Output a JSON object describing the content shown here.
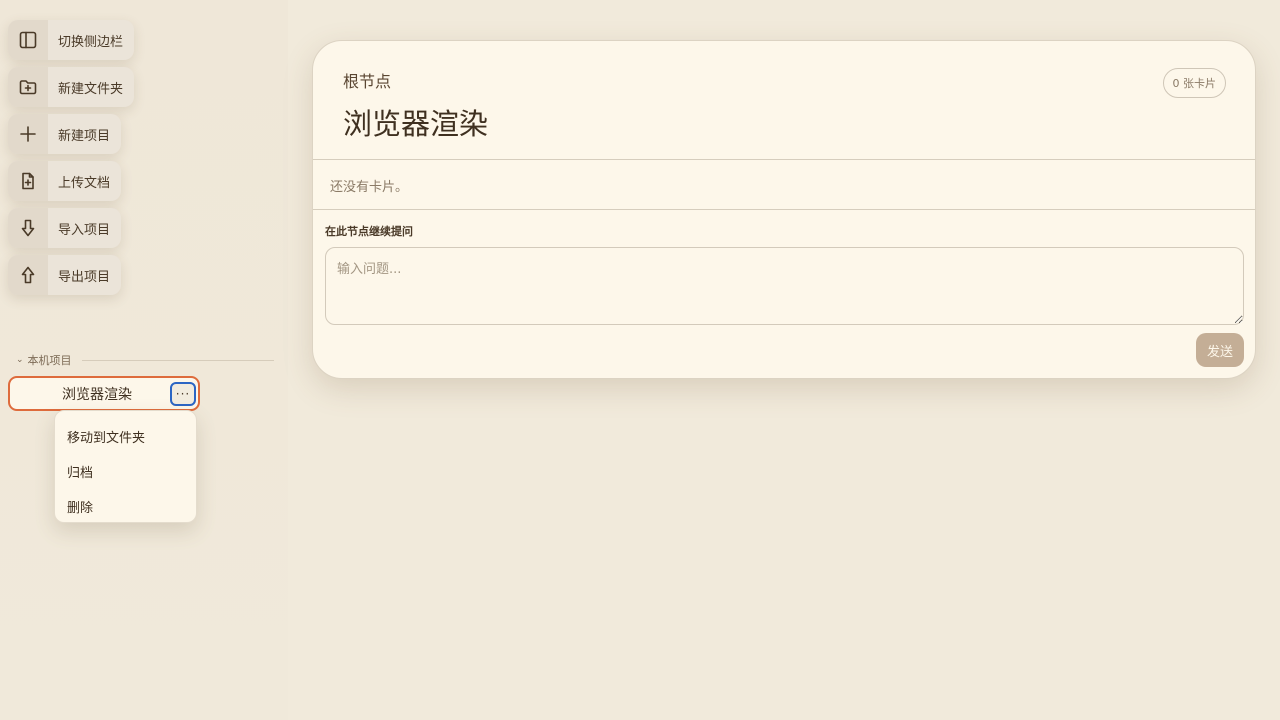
{
  "toolbar": {
    "items": [
      {
        "label": "切换侧边栏",
        "icon": "sidebar-toggle-icon"
      },
      {
        "label": "新建文件夹",
        "icon": "folder-plus-icon"
      },
      {
        "label": "新建项目",
        "icon": "plus-icon"
      },
      {
        "label": "上传文档",
        "icon": "file-plus-icon"
      },
      {
        "label": "导入项目",
        "icon": "arrow-down-icon"
      },
      {
        "label": "导出项目",
        "icon": "arrow-up-icon"
      }
    ]
  },
  "sidebar": {
    "section_title": "本机项目",
    "project": {
      "name": "浏览器渲染",
      "more_label": "···"
    },
    "context_menu": [
      "移动到文件夹",
      "归档",
      "删除"
    ]
  },
  "main": {
    "breadcrumb": "根节点",
    "title": "浏览器渲染",
    "card_count": "0 张卡片",
    "empty_text": "还没有卡片。",
    "ask_label": "在此节点继续提问",
    "input_placeholder": "输入问题...",
    "send_label": "发送"
  },
  "colors": {
    "background": "#f1eadb",
    "panel": "#fdf7ea",
    "accent_selected": "#de6b3c",
    "focus": "#2c66c4",
    "send_button": "#c4ae96"
  }
}
